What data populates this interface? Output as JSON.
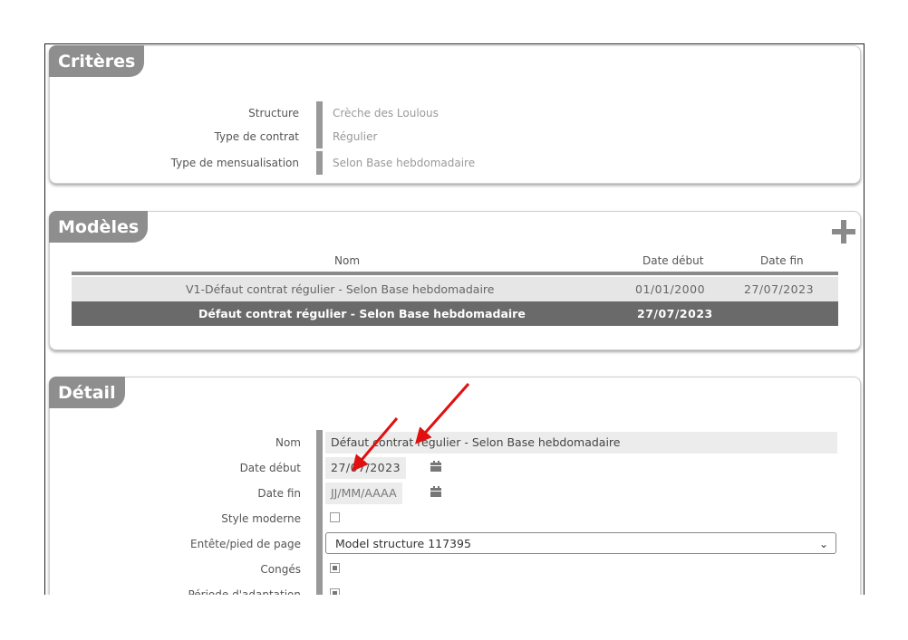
{
  "criteres": {
    "title": "Critères",
    "rows": [
      {
        "label": "Structure",
        "value": "Crèche des Loulous"
      },
      {
        "label": "Type de contrat",
        "value": "Régulier"
      },
      {
        "label": "Type de mensualisation",
        "value": "Selon Base hebdomadaire"
      }
    ]
  },
  "modeles": {
    "title": "Modèles",
    "columns": {
      "nom": "Nom",
      "date_debut": "Date début",
      "date_fin": "Date fin"
    },
    "rows": [
      {
        "nom": "V1-Défaut contrat régulier - Selon Base hebdomadaire",
        "date_debut": "01/01/2000",
        "date_fin": "27/07/2023"
      },
      {
        "nom": "Défaut contrat régulier - Selon Base hebdomadaire",
        "date_debut": "27/07/2023",
        "date_fin": ""
      }
    ]
  },
  "detail": {
    "title": "Détail",
    "labels": {
      "nom": "Nom",
      "date_debut": "Date début",
      "date_fin": "Date fin",
      "style_moderne": "Style moderne",
      "entete": "Entête/pied de page",
      "conges": "Congés",
      "periode": "Période d'adaptation"
    },
    "nom_value": "Défaut contrat régulier - Selon Base hebdomadaire",
    "date_debut_value": "27/07/2023",
    "date_fin_placeholder": "JJ/MM/AAAA",
    "entete_value": "Model structure 117395",
    "style_moderne_checked": false,
    "conges_checked": true,
    "periode_checked": true
  },
  "colors": {
    "annotation_arrow": "#e01010",
    "panel_header": "#8e8e8e",
    "selected_row": "#6a6a6a"
  }
}
